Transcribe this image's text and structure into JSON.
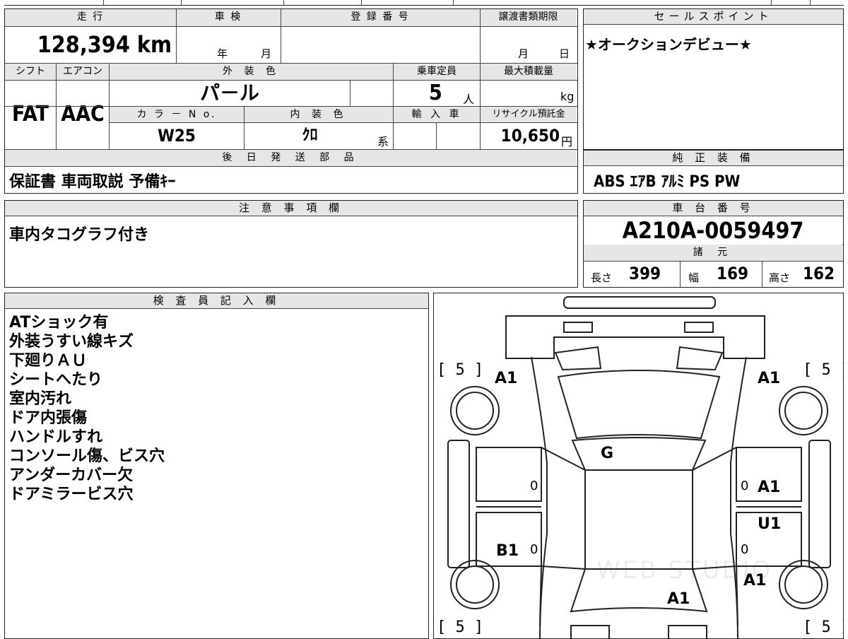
{
  "top_row": {
    "mileage_label": "走 行",
    "mileage_value": "128,394 km",
    "inspection_label": "車 検",
    "inspection_year": "年",
    "inspection_month": "月",
    "registration_label": "登 録 番 号",
    "deadline_label": "譲渡書類期限",
    "deadline_month": "月",
    "deadline_day": "日"
  },
  "second_row": {
    "shift_label": "シフト",
    "shift_value": "FAT",
    "ac_label": "エアコン",
    "ac_value": "AAC",
    "exterior_color_label": "外 装 色",
    "exterior_color_value": "パ－ル",
    "capacity_label": "乗車定員",
    "capacity_value": "5",
    "capacity_unit": "人",
    "max_load_label": "最大積載量",
    "max_load_unit": "kg",
    "color_no_label": "カ ラ － N o.",
    "color_no_value": "W25",
    "interior_color_label": "内 装 色",
    "interior_color_value": "ｸﾛ",
    "interior_color_suffix": "系",
    "import_label": "輸 入 車",
    "recycle_label": "リサイクル預託金",
    "recycle_value": "10,650",
    "recycle_unit": "円"
  },
  "later_parts": {
    "label": "後 日 発 送 部 品",
    "value": "保証書 車両取説 予備ｷｰ"
  },
  "sales_point": {
    "label": "セールスポイント",
    "value": "★オークションデビュー★"
  },
  "genuine_equipment": {
    "label": "純 正 装 備",
    "value": "ABS ｴｱB ｱﾙﾐ PS PW"
  },
  "caution": {
    "label": "注 意 事 項 欄",
    "value": "車内タコグラフ付き"
  },
  "chassis": {
    "label": "車 台 番 号",
    "value": "A210A-0059497"
  },
  "specs": {
    "label": "諸 元",
    "length_label": "長さ",
    "length_value": "399",
    "width_label": "幅",
    "width_value": "169",
    "height_label": "高さ",
    "height_value": "162"
  },
  "inspector": {
    "label": "検 査 員 記 入 欄",
    "notes": [
      "ATショック有",
      "外装うすい線キズ",
      "下廻りＡＵ",
      "シートへたり",
      "室内汚れ",
      "ドア内張傷",
      "ハンドルすれ",
      "コンソール傷、ビス穴",
      "アンダーカバー欠",
      "ドアミラービス穴"
    ]
  },
  "diagram": {
    "tire_tread": "5",
    "marks": {
      "front_left_fender": "A1",
      "front_right_fender": "A1",
      "windshield": "G",
      "left_front_door": "0",
      "right_front_door_count": "0",
      "right_front_door": "A1",
      "right_rear_door": "U1",
      "left_rear_door": "B1",
      "left_rear_door_count": "0",
      "right_rear_door_count": "0",
      "rear_right_quarter": "A1",
      "rear_center": "A1"
    },
    "watermark": "WEB STUDIO"
  }
}
